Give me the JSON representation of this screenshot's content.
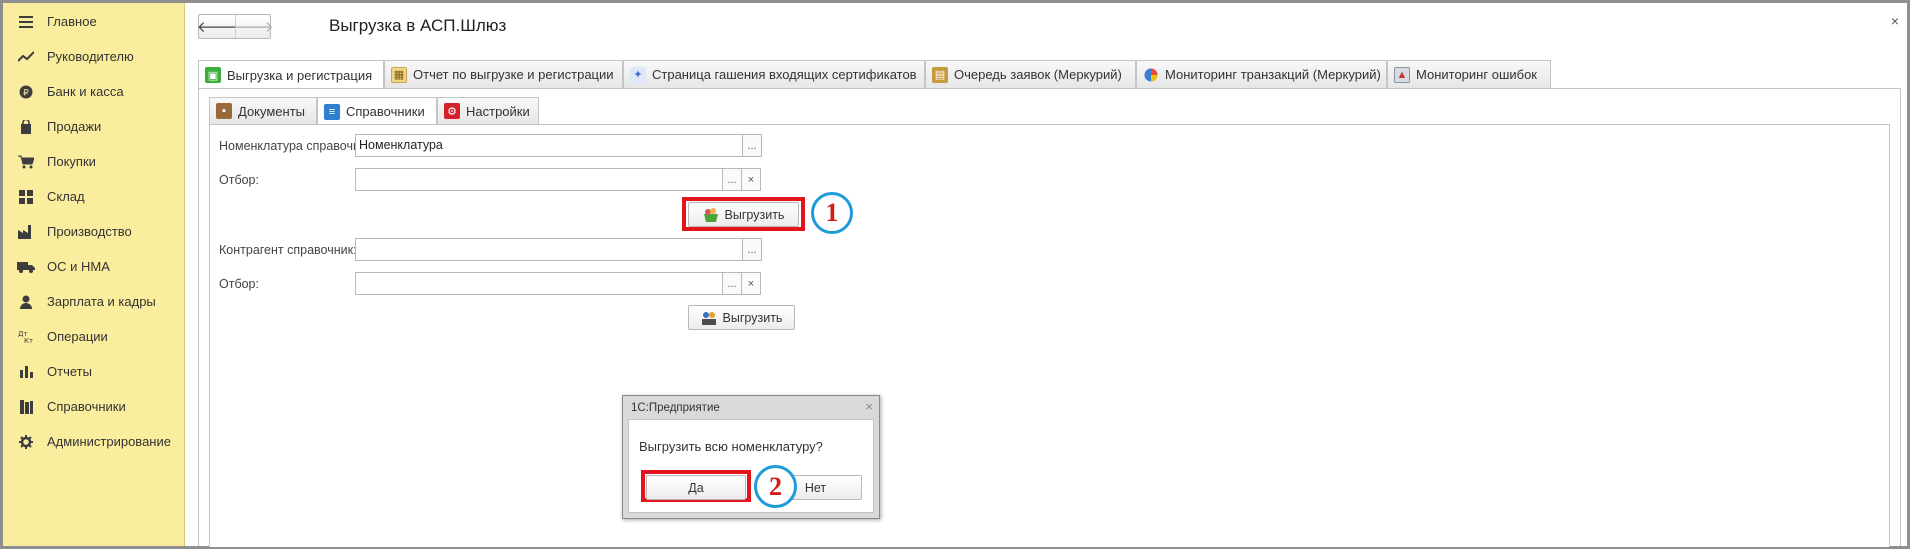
{
  "sidebar": {
    "items": [
      {
        "label": "Главное",
        "icon": "menu-lines-icon"
      },
      {
        "label": "Руководителю",
        "icon": "trend-icon"
      },
      {
        "label": "Банк и касса",
        "icon": "coin-icon"
      },
      {
        "label": "Продажи",
        "icon": "bag-icon"
      },
      {
        "label": "Покупки",
        "icon": "cart-icon"
      },
      {
        "label": "Склад",
        "icon": "grid-icon"
      },
      {
        "label": "Производство",
        "icon": "factory-icon"
      },
      {
        "label": "ОС и НМА",
        "icon": "truck-icon"
      },
      {
        "label": "Зарплата и кадры",
        "icon": "person-icon"
      },
      {
        "label": "Операции",
        "icon": "dt-kt-icon"
      },
      {
        "label": "Отчеты",
        "icon": "bar-chart-icon"
      },
      {
        "label": "Справочники",
        "icon": "books-icon"
      },
      {
        "label": "Администрирование",
        "icon": "gear-icon"
      }
    ]
  },
  "header": {
    "back_arrow": "🡐",
    "forward_arrow": "🡒",
    "title": "Выгрузка в АСП.Шлюз",
    "close": "×"
  },
  "tabs_top": [
    {
      "label": "Выгрузка и регистрация"
    },
    {
      "label": "Отчет по выгрузке и регистрации"
    },
    {
      "label": "Страница гашения входящих сертификатов"
    },
    {
      "label": "Очередь заявок (Меркурий)"
    },
    {
      "label": "Мониторинг транзакций (Меркурий)"
    },
    {
      "label": "Мониторинг ошибок"
    }
  ],
  "tabs_inner": [
    {
      "label": "Документы"
    },
    {
      "label": "Справочники"
    },
    {
      "label": "Настройки"
    }
  ],
  "form": {
    "nomenclature_label": "Номенклатура справочник:",
    "nomenclature_value": "Номенклатура",
    "filter1_label": "Отбор:",
    "filter1_value": "",
    "upload1_label": "Выгрузить",
    "contractor_label": "Контрагент справочник:",
    "contractor_value": "",
    "filter2_label": "Отбор:",
    "filter2_value": "",
    "upload2_label": "Выгрузить",
    "select_glyph": "...",
    "clear_glyph": "×"
  },
  "markers": {
    "step1": "1",
    "step2": "2"
  },
  "dialog": {
    "title": "1С:Предприятие",
    "close": "×",
    "question": "Выгрузить всю номенклатуру?",
    "yes_label": "Да",
    "no_label": "Нет"
  },
  "colors": {
    "sidebar_bg": "#fbed9e",
    "highlight_red": "#e3141c",
    "marker_blue": "#1f9bd8"
  }
}
